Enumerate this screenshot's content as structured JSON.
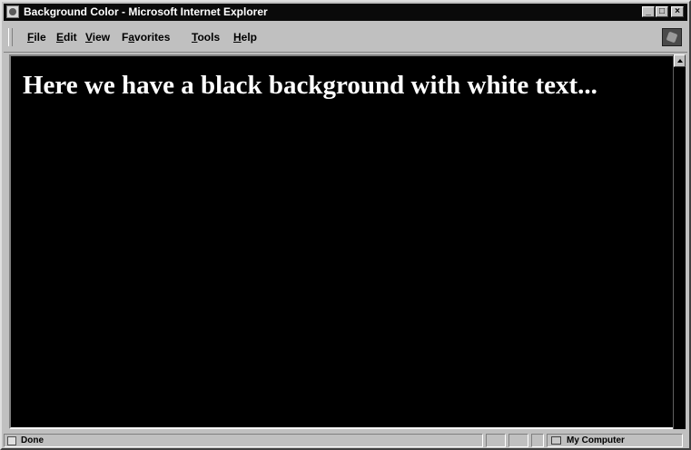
{
  "window": {
    "title": "Background Color - Microsoft Internet Explorer"
  },
  "menubar": {
    "items": [
      {
        "label": "File",
        "access_key": "F"
      },
      {
        "label": "Edit",
        "access_key": "E"
      },
      {
        "label": "View",
        "access_key": "V"
      },
      {
        "label": "Favorites",
        "access_key": "a"
      },
      {
        "label": "Tools",
        "access_key": "T"
      },
      {
        "label": "Help",
        "access_key": "H"
      }
    ]
  },
  "page": {
    "heading": "Here we have a black background with white text...",
    "background_color": "#000000",
    "text_color": "#ffffff"
  },
  "statusbar": {
    "status": "Done",
    "zone": "My Computer"
  },
  "icons": {
    "app": "ie-page-icon",
    "brand": "windows-logo-icon",
    "status": "page-done-icon",
    "zone": "computer-icon"
  }
}
